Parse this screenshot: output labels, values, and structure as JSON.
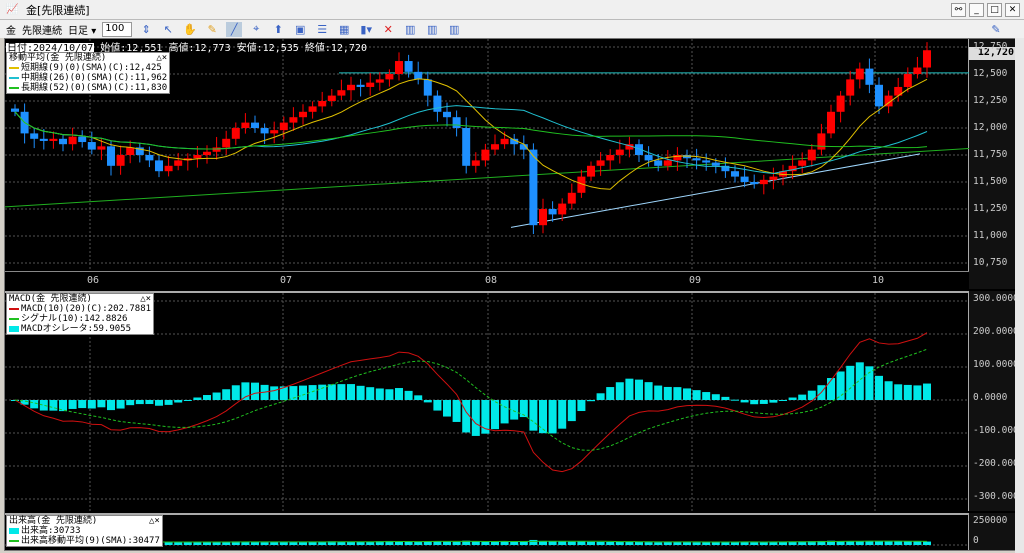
{
  "window": {
    "title": "金[先限連続]"
  },
  "toolbar": {
    "symbol": "金",
    "contract": "先限連続",
    "period": "日足",
    "period_arrow": "▾",
    "count": "100"
  },
  "info": {
    "date": "日付:2024/10/07",
    "open": "始値:12,551",
    "high": "高値:12,773",
    "low": "安値:12,535",
    "close": "終値:12,720"
  },
  "ma_legend": {
    "title": "移動平均(金 先限連続)",
    "short": "短期線(9)(0)(SMA)(C):12,425",
    "mid": "中期線(26)(0)(SMA)(C):11,962",
    "long": "長期線(52)(0)(SMA)(C):11,830"
  },
  "macd_legend": {
    "title": "MACD(金 先限連続)",
    "macd": "MACD(10)(20)(C):202.7881",
    "signal": "シグナル(10):142.8826",
    "osc": "MACDオシレータ:59.9055"
  },
  "vol_legend": {
    "title": "出来高(金 先限連続)",
    "vol": "出来高:30733",
    "ma": "出来高移動平均(9)(SMA):30477"
  },
  "legend_controls": "△×",
  "price_axis": [
    "12,750",
    "12,500",
    "12,250",
    "12,000",
    "11,750",
    "11,500",
    "11,250",
    "11,000",
    "10,750"
  ],
  "price_axis_values": [
    12750,
    12500,
    12250,
    12000,
    11750,
    11500,
    11250,
    11000,
    10750
  ],
  "last_price": "12,720",
  "macd_axis": [
    "300.0000",
    "200.0000",
    "100.0000",
    "0.0000",
    "-100.0000",
    "-200.0000",
    "-300.0000"
  ],
  "vol_axis": [
    "250000",
    "0"
  ],
  "months": [
    "06",
    "07",
    "08",
    "09",
    "10"
  ],
  "colors": {
    "up": "#ff0000",
    "down": "#1e90ff",
    "short": "#e0c000",
    "mid": "#20c0d0",
    "long": "#20c020",
    "macd": "#d01010",
    "signal": "#20c020",
    "osc": "#00e8e8"
  },
  "closes": [
    12150,
    11950,
    11900,
    11880,
    11900,
    11850,
    11920,
    11870,
    11800,
    11830,
    11650,
    11750,
    11820,
    11750,
    11700,
    11600,
    11650,
    11700,
    11720,
    11750,
    11780,
    11820,
    11900,
    12000,
    12050,
    12000,
    11950,
    11980,
    12050,
    12100,
    12150,
    12200,
    12250,
    12300,
    12350,
    12400,
    12380,
    12420,
    12450,
    12500,
    12620,
    12520,
    12450,
    12300,
    12150,
    12100,
    12000,
    11650,
    11700,
    11800,
    11850,
    11900,
    11850,
    11800,
    11100,
    11250,
    11200,
    11300,
    11400,
    11550,
    11650,
    11700,
    11750,
    11800,
    11850,
    11750,
    11700,
    11650,
    11700,
    11750,
    11720,
    11700,
    11680,
    11650,
    11600,
    11550,
    11500,
    11480,
    11520,
    11550,
    11600,
    11650,
    11700,
    11800,
    11950,
    12150,
    12300,
    12450,
    12550,
    12400,
    12200,
    12300,
    12380,
    12500,
    12560,
    12720
  ],
  "volume": [
    28000,
    25000,
    31000,
    27000,
    22000,
    30000,
    26000,
    24000,
    29000,
    33000,
    27000,
    25000,
    28000,
    30000,
    26000,
    24000,
    23000,
    27000,
    29000,
    31000,
    26000,
    25000,
    28000,
    32000,
    30000,
    27000,
    25000,
    29000,
    31000,
    28000,
    26000,
    27000,
    30000,
    33000,
    29000,
    27000,
    28000,
    31000,
    34000,
    36000,
    32000,
    30000,
    29000,
    33000,
    35000,
    30000,
    28000,
    38000,
    33000,
    30000,
    29000,
    31000,
    28000,
    34000,
    45000,
    36000,
    33000,
    31000,
    30000,
    32000,
    29000,
    28000,
    27000,
    30000,
    31000,
    28000,
    26000,
    25000,
    27000,
    29000,
    26000,
    25000,
    27000,
    28000,
    30000,
    29000,
    27000,
    26000,
    28000,
    29000,
    30000,
    31000,
    32000,
    34000,
    36000,
    38000,
    35000,
    33000,
    34000,
    36000,
    33000,
    31000,
    32000,
    33000,
    31000,
    30733
  ]
}
